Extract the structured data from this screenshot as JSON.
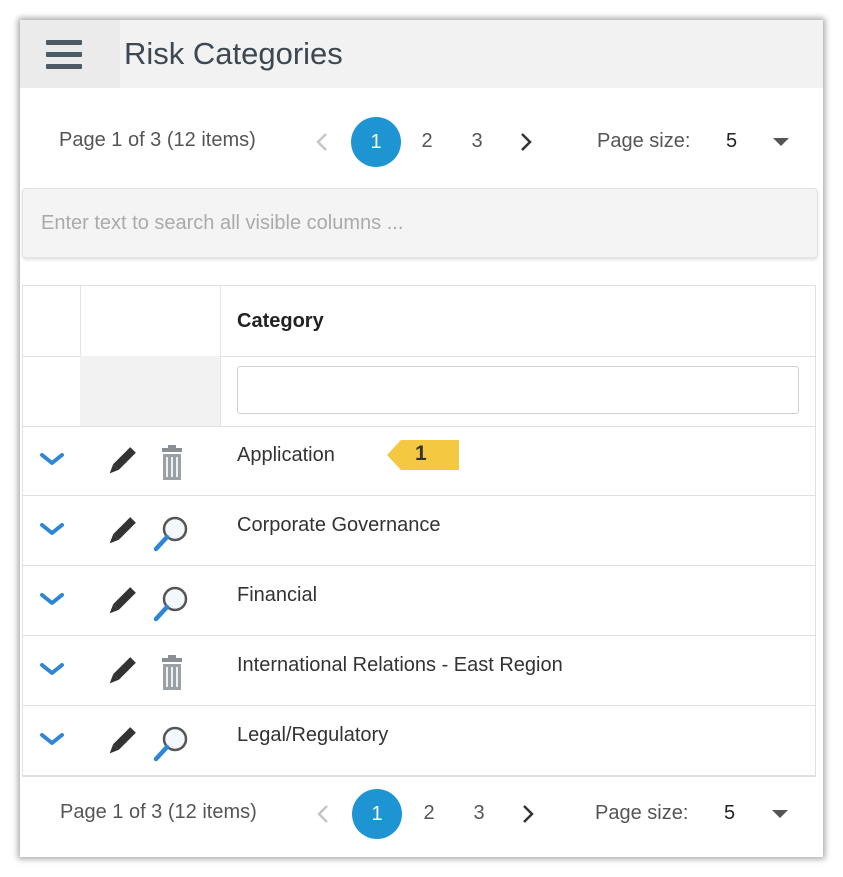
{
  "header": {
    "title": "Risk Categories"
  },
  "pager": {
    "info": "Page 1 of 3 (12 items)",
    "pages": [
      "1",
      "2",
      "3"
    ],
    "current_page": "1",
    "page_size_label": "Page size:",
    "page_size_value": "5"
  },
  "search": {
    "placeholder": "Enter text to search all visible columns ..."
  },
  "grid": {
    "column_header": "Category",
    "filter_value": "",
    "rows": [
      {
        "category": "Application",
        "action_icon": "trash-icon"
      },
      {
        "category": "Corporate Governance",
        "action_icon": "magnifier-icon"
      },
      {
        "category": "Financial",
        "action_icon": "magnifier-icon"
      },
      {
        "category": "International Relations - East Region",
        "action_icon": "trash-icon"
      },
      {
        "category": "Legal/Regulatory",
        "action_icon": "magnifier-icon"
      }
    ]
  },
  "callout": {
    "number": "1"
  },
  "colors": {
    "accent_blue": "#1f94d2",
    "header_bg": "#f2f2f2",
    "callout_yellow": "#f5c842",
    "chevron_blue": "#2e86d4"
  }
}
